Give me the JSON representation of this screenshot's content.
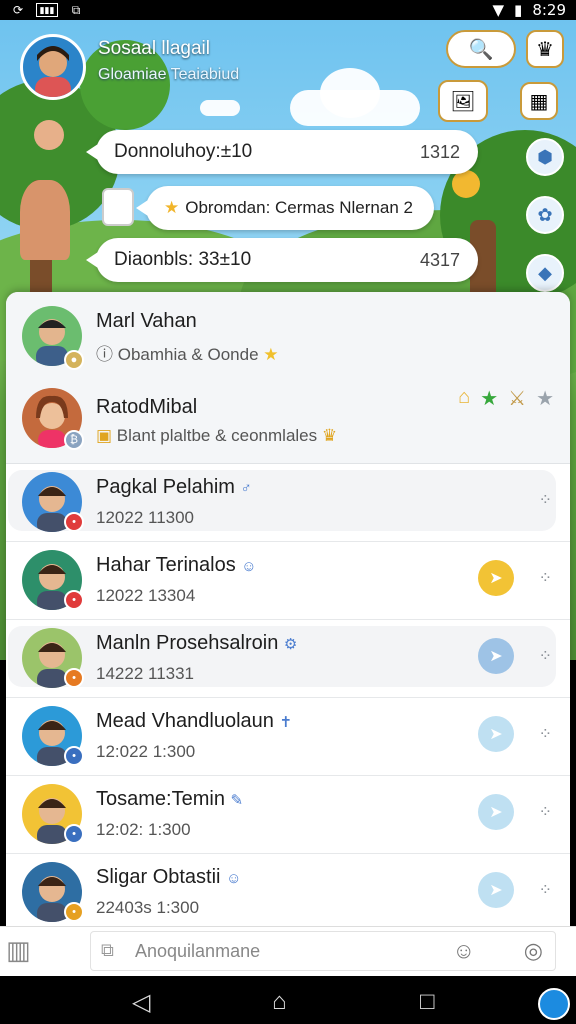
{
  "status_bar": {
    "time": "8:29"
  },
  "profile": {
    "name": "Sosaal llagail",
    "subtitle": "Gloamiae Teaiabiud"
  },
  "bubbles": [
    {
      "text": "Donnoluhoy:±10",
      "count": "1312"
    },
    {
      "text": "Obromdan: Cermas Nlernan 2",
      "count": ""
    },
    {
      "text": "Diaonbls: 33±10",
      "count": "4317"
    }
  ],
  "featured": [
    {
      "name": "Marl Vahan",
      "subtitle": "Obamhia & Oonde"
    },
    {
      "name": "RatodMibal",
      "subtitle": "Blant plaltbe & ceonmlales"
    }
  ],
  "contacts": [
    {
      "name": "Pagkal Pelahim",
      "time": "12022 11300",
      "emoji": "♂"
    },
    {
      "name": "Hahar Terinalos",
      "time": "12022 13304",
      "emoji": "☺"
    },
    {
      "name": "Manln Prosehsalroin",
      "time": "14222 11331",
      "emoji": "⚙"
    },
    {
      "name": "Mead Vhandluolaun",
      "time": "12:022 1:300",
      "emoji": "✝"
    },
    {
      "name": "Tosame:Temin",
      "time": "12:02: 1:300",
      "emoji": "✎"
    },
    {
      "name": "Sligar Obtastii",
      "time": "22403s 1:300",
      "emoji": "☺"
    }
  ],
  "input": {
    "placeholder": "Anoquilanmane"
  },
  "colors": {
    "accent_yellow": "#f2c335",
    "accent_blue": "#9ec3e6",
    "panel_bg": "#ffffff"
  }
}
